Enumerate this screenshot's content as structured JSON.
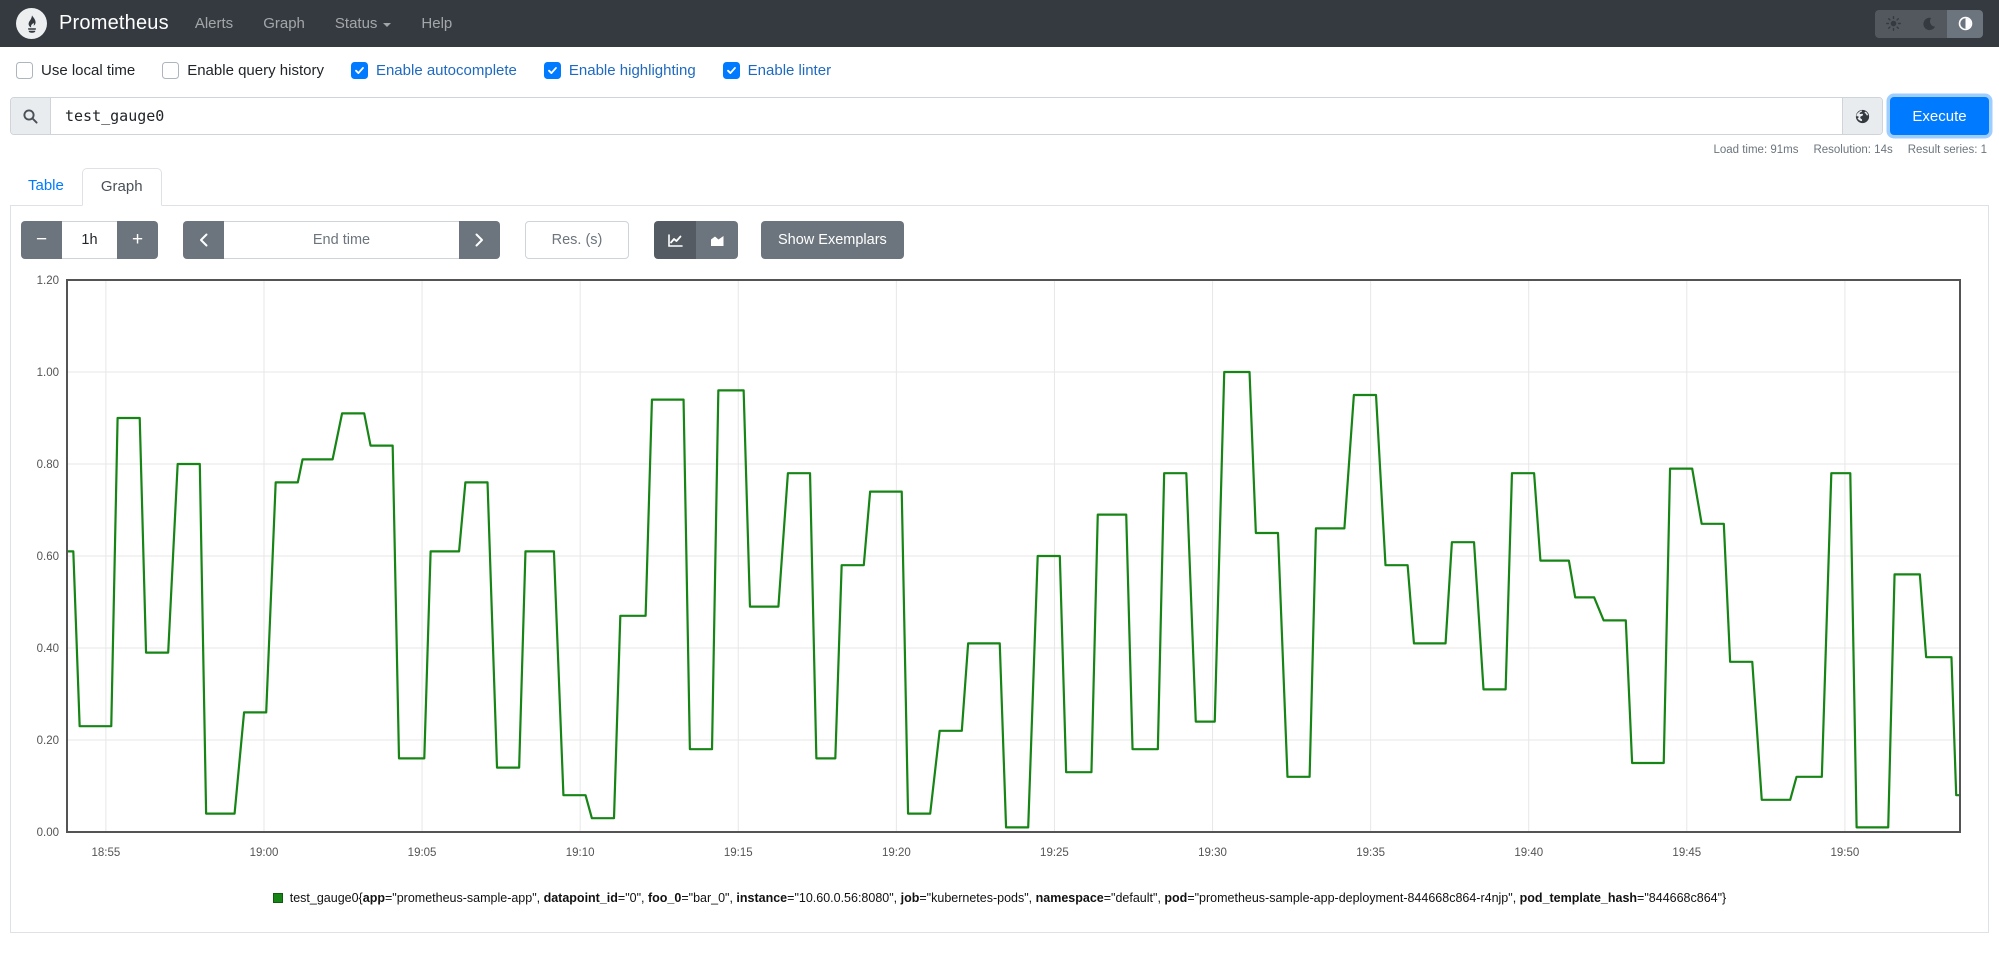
{
  "navbar": {
    "brand": "Prometheus",
    "links": [
      {
        "label": "Alerts"
      },
      {
        "label": "Graph"
      },
      {
        "label": "Status",
        "has_caret": true
      },
      {
        "label": "Help"
      }
    ],
    "theme_buttons": [
      {
        "name": "light-theme",
        "icon": "sun-icon",
        "active": false
      },
      {
        "name": "dark-theme",
        "icon": "moon-icon",
        "active": false
      },
      {
        "name": "auto-theme",
        "icon": "contrast-icon",
        "active": true
      }
    ]
  },
  "options": {
    "items": [
      {
        "label": "Use local time",
        "checked": false
      },
      {
        "label": "Enable query history",
        "checked": false
      },
      {
        "label": "Enable autocomplete",
        "checked": true
      },
      {
        "label": "Enable highlighting",
        "checked": true
      },
      {
        "label": "Enable linter",
        "checked": true
      }
    ]
  },
  "query": {
    "value": "test_gauge0",
    "search_icon": "magnifier-icon",
    "explorer_icon": "globe-icon",
    "execute_label": "Execute"
  },
  "stats": {
    "items": [
      "Load time: 91ms",
      "Resolution: 14s",
      "Result series: 1"
    ]
  },
  "tabs": [
    {
      "label": "Table",
      "active": false
    },
    {
      "label": "Graph",
      "active": true
    }
  ],
  "controls": {
    "range_minus": "−",
    "range_value": "1h",
    "range_plus": "+",
    "end_time_placeholder": "End time",
    "res_placeholder": "Res. (s)",
    "show_exemplars_label": "Show Exemplars"
  },
  "chart_data": {
    "type": "line",
    "title": "",
    "line_color": "#168516",
    "grid_color": "#e7e7e7",
    "border_color": "#545454",
    "ylim": [
      0,
      1.2
    ],
    "y_ticks": [
      "0.00",
      "0.20",
      "0.40",
      "0.60",
      "0.80",
      "1.00",
      "1.20"
    ],
    "x_ticks": [
      "18:55",
      "19:00",
      "19:05",
      "19:10",
      "19:15",
      "19:20",
      "19:25",
      "19:30",
      "19:35",
      "19:40",
      "19:45",
      "19:50"
    ],
    "x_window_minutes": 59.87,
    "x_first_tick_minute": 1.23,
    "x_tick_interval_minutes": 5,
    "grid": true,
    "legend_position": "bottom-center",
    "series": [
      {
        "name": "test_gauge0{app=\"prometheus-sample-app\", datapoint_id=\"0\", foo_0=\"bar_0\", instance=\"10.60.0.56:8080\", job=\"kubernetes-pods\", namespace=\"default\", pod=\"prometheus-sample-app-deployment-844668c864-r4njp\", pod_template_hash=\"844668c864\"}",
        "plateaus_t_start_t_end_value": [
          [
            0.0,
            0.2,
            0.61
          ],
          [
            0.4,
            1.4,
            0.23
          ],
          [
            1.6,
            2.3,
            0.9
          ],
          [
            2.5,
            3.2,
            0.39
          ],
          [
            3.5,
            4.2,
            0.8
          ],
          [
            4.4,
            5.3,
            0.04
          ],
          [
            5.6,
            6.3,
            0.26
          ],
          [
            6.6,
            7.3,
            0.76
          ],
          [
            7.45,
            8.4,
            0.81
          ],
          [
            8.7,
            9.4,
            0.91
          ],
          [
            9.6,
            10.3,
            0.84
          ],
          [
            10.5,
            11.3,
            0.16
          ],
          [
            11.5,
            12.4,
            0.61
          ],
          [
            12.6,
            13.3,
            0.76
          ],
          [
            13.6,
            14.3,
            0.14
          ],
          [
            14.5,
            15.4,
            0.61
          ],
          [
            15.7,
            16.4,
            0.08
          ],
          [
            16.6,
            17.3,
            0.03
          ],
          [
            17.5,
            18.3,
            0.47
          ],
          [
            18.5,
            19.5,
            0.94
          ],
          [
            19.7,
            20.4,
            0.18
          ],
          [
            20.6,
            21.4,
            0.96
          ],
          [
            21.6,
            22.5,
            0.49
          ],
          [
            22.8,
            23.5,
            0.78
          ],
          [
            23.7,
            24.3,
            0.16
          ],
          [
            24.5,
            25.2,
            0.58
          ],
          [
            25.4,
            26.4,
            0.74
          ],
          [
            26.6,
            27.3,
            0.04
          ],
          [
            27.6,
            28.3,
            0.22
          ],
          [
            28.5,
            29.5,
            0.41
          ],
          [
            29.7,
            30.4,
            0.01
          ],
          [
            30.7,
            31.4,
            0.6
          ],
          [
            31.6,
            32.4,
            0.13
          ],
          [
            32.6,
            33.5,
            0.69
          ],
          [
            33.7,
            34.5,
            0.18
          ],
          [
            34.7,
            35.4,
            0.78
          ],
          [
            35.7,
            36.3,
            0.24
          ],
          [
            36.6,
            37.4,
            1.0
          ],
          [
            37.6,
            38.3,
            0.65
          ],
          [
            38.6,
            39.3,
            0.12
          ],
          [
            39.5,
            40.4,
            0.66
          ],
          [
            40.7,
            41.4,
            0.95
          ],
          [
            41.7,
            42.4,
            0.58
          ],
          [
            42.6,
            43.6,
            0.41
          ],
          [
            43.8,
            44.5,
            0.63
          ],
          [
            44.8,
            45.5,
            0.31
          ],
          [
            45.7,
            46.4,
            0.78
          ],
          [
            46.6,
            47.5,
            0.59
          ],
          [
            47.7,
            48.3,
            0.51
          ],
          [
            48.6,
            49.3,
            0.46
          ],
          [
            49.5,
            50.5,
            0.15
          ],
          [
            50.7,
            51.4,
            0.79
          ],
          [
            51.7,
            52.4,
            0.67
          ],
          [
            52.6,
            53.3,
            0.37
          ],
          [
            53.6,
            54.5,
            0.07
          ],
          [
            54.7,
            55.5,
            0.12
          ],
          [
            55.8,
            56.4,
            0.78
          ],
          [
            56.6,
            57.6,
            0.01
          ],
          [
            57.8,
            58.6,
            0.56
          ],
          [
            58.8,
            59.6,
            0.38
          ],
          [
            59.75,
            59.87,
            0.08
          ]
        ]
      }
    ]
  },
  "legend": {
    "swatch_color": "#168516",
    "metric": "test_gauge0",
    "labels": [
      [
        "app",
        "prometheus-sample-app"
      ],
      [
        "datapoint_id",
        "0"
      ],
      [
        "foo_0",
        "bar_0"
      ],
      [
        "instance",
        "10.60.0.56:8080"
      ],
      [
        "job",
        "kubernetes-pods"
      ],
      [
        "namespace",
        "default"
      ],
      [
        "pod",
        "prometheus-sample-app-deployment-844668c864-r4njp"
      ],
      [
        "pod_template_hash",
        "844668c864"
      ]
    ]
  },
  "colors": {
    "navbar_bg": "#343a40",
    "accent_blue": "#007bff",
    "checked_label_blue": "#1e6ac1",
    "secondary_gray": "#6c757d",
    "line_green": "#168516"
  }
}
